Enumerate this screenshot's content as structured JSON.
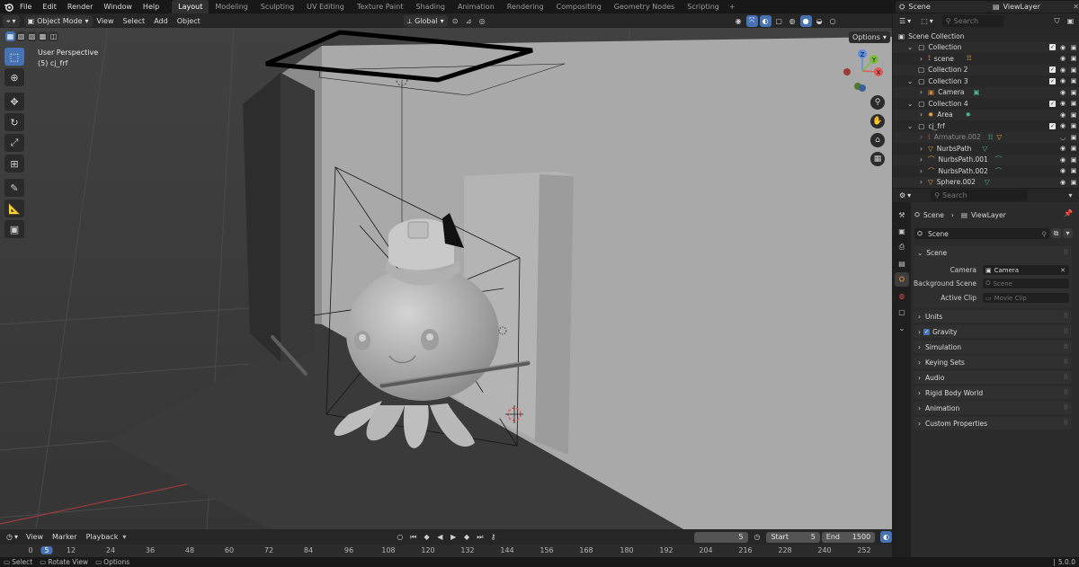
{
  "menu": [
    "File",
    "Edit",
    "Render",
    "Window",
    "Help"
  ],
  "workspaces": [
    "Layout",
    "Modeling",
    "Sculpting",
    "UV Editing",
    "Texture Paint",
    "Shading",
    "Animation",
    "Rendering",
    "Compositing",
    "Geometry Nodes",
    "Scripting"
  ],
  "workspace_add": "+",
  "top_right": {
    "scene": "Scene",
    "view_layer": "ViewLayer"
  },
  "viewport_header": {
    "mode": "Object Mode",
    "links": [
      "View",
      "Select",
      "Add",
      "Object"
    ],
    "transform": "Global",
    "options": "Options"
  },
  "viewport": {
    "perspective": "User Perspective",
    "object_info": "(5) cj_frf",
    "gizmo_axes": {
      "x": "X",
      "y": "Y",
      "z": "Z"
    }
  },
  "outliner": {
    "search_placeholder": "Search",
    "rows": [
      {
        "label": "Scene Collection",
        "indent": 0,
        "icon": "scene-collection-icon"
      },
      {
        "label": "Collection",
        "indent": 1,
        "icon": "collection-icon"
      },
      {
        "label": "scene",
        "indent": 2,
        "icon": "armature-icon"
      },
      {
        "label": "Collection 2",
        "indent": 1,
        "icon": "collection-icon"
      },
      {
        "label": "Collection 3",
        "indent": 1,
        "icon": "collection-icon"
      },
      {
        "label": "Camera",
        "indent": 2,
        "icon": "camera-icon"
      },
      {
        "label": "Collection 4",
        "indent": 1,
        "icon": "collection-icon"
      },
      {
        "label": "Area",
        "indent": 2,
        "icon": "light-icon"
      },
      {
        "label": "cj_frf",
        "indent": 1,
        "icon": "collection-icon"
      },
      {
        "label": "Armature.002",
        "indent": 2,
        "icon": "armature-icon"
      },
      {
        "label": "NurbsPath",
        "indent": 2,
        "icon": "mesh-icon"
      },
      {
        "label": "NurbsPath.001",
        "indent": 2,
        "icon": "curve-icon"
      },
      {
        "label": "NurbsPath.002",
        "indent": 2,
        "icon": "curve-icon"
      },
      {
        "label": "Sphere.002",
        "indent": 2,
        "icon": "mesh-icon"
      }
    ]
  },
  "properties": {
    "search_placeholder": "Search",
    "breadcrumb": [
      "Scene",
      "ViewLayer"
    ],
    "datablock": "Scene",
    "panel_scene": "Scene",
    "fields": [
      {
        "label": "Camera",
        "value": "Camera"
      },
      {
        "label": "Background Scene",
        "value": "Scene"
      },
      {
        "label": "Active Clip",
        "value": "Movie Clip"
      }
    ],
    "panels": [
      "Units",
      "Gravity",
      "Simulation",
      "Keying Sets",
      "Audio",
      "Rigid Body World",
      "Animation",
      "Custom Properties"
    ]
  },
  "timeline": {
    "links": [
      "View",
      "Marker",
      "Playback"
    ],
    "current_frame": "5",
    "start_label": "Start",
    "start": "5",
    "end_label": "End",
    "end": "1500",
    "ticks": [
      "0",
      "5",
      "12",
      "24",
      "36",
      "48",
      "60",
      "72",
      "84",
      "96",
      "108",
      "120",
      "132",
      "144",
      "156",
      "168",
      "180",
      "192",
      "204",
      "216",
      "228",
      "240",
      "252"
    ]
  },
  "status": {
    "select": "Select",
    "rotate": "Rotate View",
    "options": "Options",
    "version": "5.0.0"
  },
  "colors": {
    "accent": "#4772b3",
    "viewport_bg": "#3d3d3d",
    "panel_bg": "#2b2b2b"
  }
}
